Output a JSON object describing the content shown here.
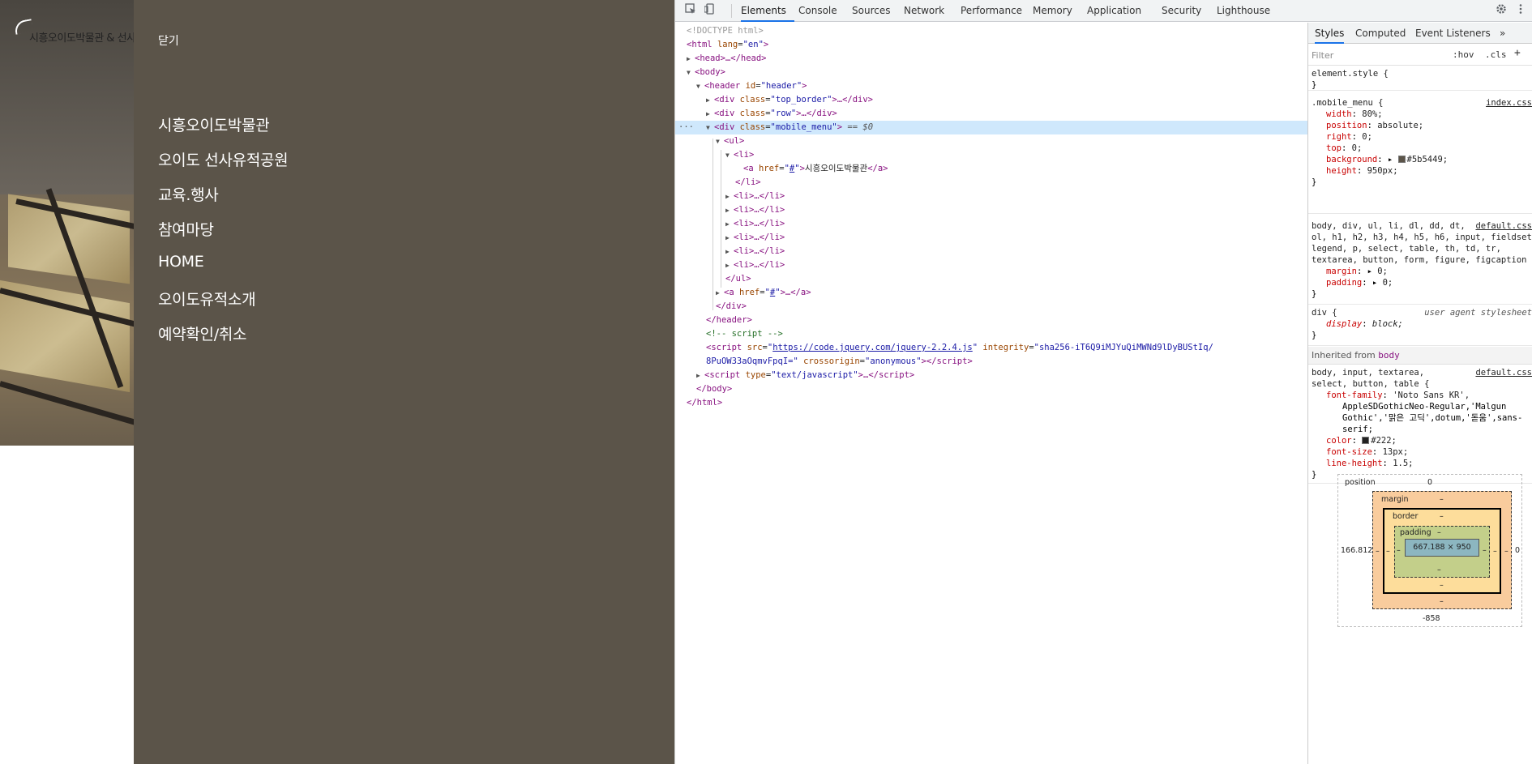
{
  "site": {
    "logo_text": "시흥오이도박물관 & 선사유",
    "close_label": "닫기",
    "menu_items": [
      "시흥오이도박물관",
      "오이도 선사유적공원",
      "교육.행사",
      "참여마당",
      "HOME",
      "오이도유적소개",
      "예약확인/취소"
    ],
    "menu_background": "#5b5449"
  },
  "devtools": {
    "tabs": [
      "Elements",
      "Console",
      "Sources",
      "Network",
      "Performance",
      "Memory",
      "Application",
      "Security",
      "Lighthouse"
    ],
    "active_tab": "Elements",
    "icons": [
      "inspect-icon",
      "device-toggle-icon",
      "settings-icon",
      "more-icon"
    ],
    "dom": {
      "doctype": "<!DOCTYPE html>",
      "html_open_tag": "html",
      "html_attr_name": "lang",
      "html_attr_value": "en",
      "head_collapsed": "<head>…</head>",
      "body": "body",
      "header_tag": "header",
      "header_attr_name": "id",
      "header_attr_value": "header",
      "div_top_border": "top_border",
      "div_row": "row",
      "div_mobile_menu": "mobile_menu",
      "selected_suffix": "== $0",
      "ul": "ul",
      "li": "li",
      "a_href_value": "#",
      "a_text": "시흥오이도박물관",
      "li_collapsed": "<li>…</li>",
      "a_collapsed": "…</a>",
      "header_close": "</header>",
      "comment": "<!-- script -->",
      "script_src_url": "https://code.jquery.com/jquery-2.2.4.js",
      "integrity_value_1": "\"sha256-iT6Q9iMJYuQiMWNd9lDyBUStIq/",
      "integrity_value_2": "8PuOW33aOqmvFpqI=\"",
      "crossorigin_value": "\"anonymous\"",
      "script_type_value": "\"text/javascript\"",
      "body_close": "</body>",
      "html_close": "</html>"
    },
    "styles": {
      "tabs": [
        "Styles",
        "Computed",
        "Event Listeners"
      ],
      "more_tabs": "»",
      "filter_placeholder": "Filter",
      "hov": ":hov",
      "cls": ".cls",
      "plus": "+",
      "element_style": "element.style {",
      "close_brace": "}",
      "rule1_selector": ".mobile_menu {",
      "rule1_source": "index.css",
      "rule1_props": [
        {
          "name": "width",
          "value": "80%;"
        },
        {
          "name": "position",
          "value": "absolute;"
        },
        {
          "name": "right",
          "value": "0;"
        },
        {
          "name": "top",
          "value": "0;"
        },
        {
          "name": "background",
          "value": "#5b5449;"
        },
        {
          "name": "height",
          "value": "950px;"
        }
      ],
      "rule2_selector_lines": [
        "body, div, ul, li, dl, dd, dt,",
        "ol, h1, h2, h3, h4, h5, h6, input, fieldset,",
        "legend, p, select, table, th, td, tr,",
        "textarea, button, form, figure, figcaption {"
      ],
      "rule2_source": "default.css",
      "rule2_props": [
        {
          "name": "margin",
          "value": "0;"
        },
        {
          "name": "padding",
          "value": "0;"
        }
      ],
      "rule3_selector": "div {",
      "rule3_source": "user agent stylesheet",
      "rule3_prop_name": "display",
      "rule3_prop_value": "block;",
      "inherited_label": "Inherited from",
      "inherited_from": "body",
      "rule4_selector_lines": [
        "body, input, textarea,",
        "select, button, table {"
      ],
      "rule4_source": "default.css",
      "rule4_font_family_name": "font-family",
      "rule4_font_family_lines": [
        "'Noto Sans KR',",
        "AppleSDGothicNeo-Regular,'Malgun",
        "Gothic','맑은 고딕',dotum,'돋움',sans-",
        "serif;"
      ],
      "rule4_props": [
        {
          "name": "color",
          "value": "#222;"
        },
        {
          "name": "font-size",
          "value": "13px;"
        },
        {
          "name": "line-height",
          "value": "1.5;"
        }
      ]
    },
    "box_model": {
      "position_label": "position",
      "position_top": "0",
      "position_left": "166.812",
      "position_right": "0",
      "position_bottom": "-858",
      "margin_label": "margin",
      "border_label": "border",
      "padding_label": "padding",
      "dash": "–",
      "content_size": "667.188 × 950"
    }
  }
}
